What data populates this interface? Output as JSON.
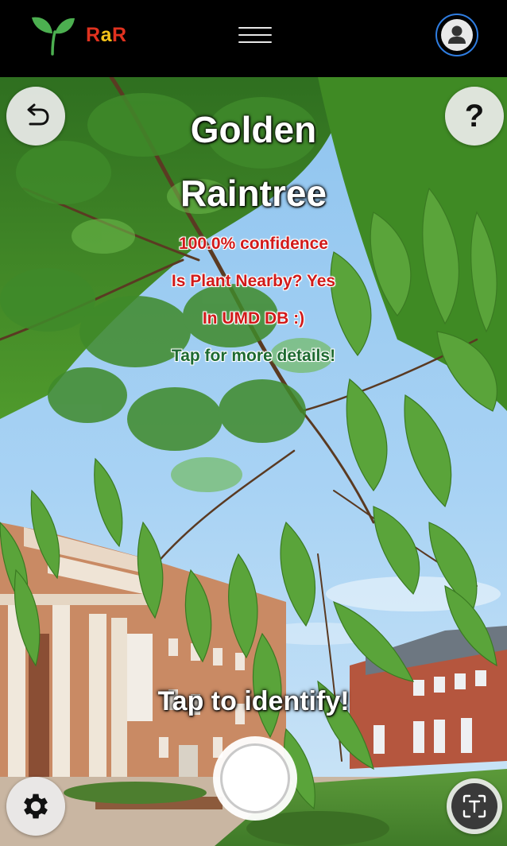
{
  "header": {
    "brand": {
      "r1": "R",
      "a": "a",
      "r2": "R"
    },
    "logo_icon": "sprout-icon",
    "menu_icon": "hamburger-menu-icon",
    "profile_icon": "user-account-icon",
    "colors": {
      "background": "#000000",
      "brand_red": "#e0321f",
      "brand_yellow": "#f3c21a",
      "profile_ring": "#2f7de1",
      "logo_green": "#4caf50"
    }
  },
  "camera": {
    "back_icon": "undo-arrow-icon",
    "help_label": "?",
    "settings_icon": "gear-icon",
    "text_scan_icon": "text-recognition-icon",
    "shutter_icon": "shutter-button",
    "identify_prompt": "Tap to identify!"
  },
  "result": {
    "name_line1": "Golden",
    "name_line2": "Raintree",
    "confidence": "100.0% confidence",
    "nearby": "Is Plant Nearby? Yes",
    "database": "In UMD DB :)",
    "details_prompt": "Tap for more details!",
    "colors": {
      "name": "#ffffff",
      "info": "#d11a1a",
      "details": "#1d6a30"
    }
  }
}
